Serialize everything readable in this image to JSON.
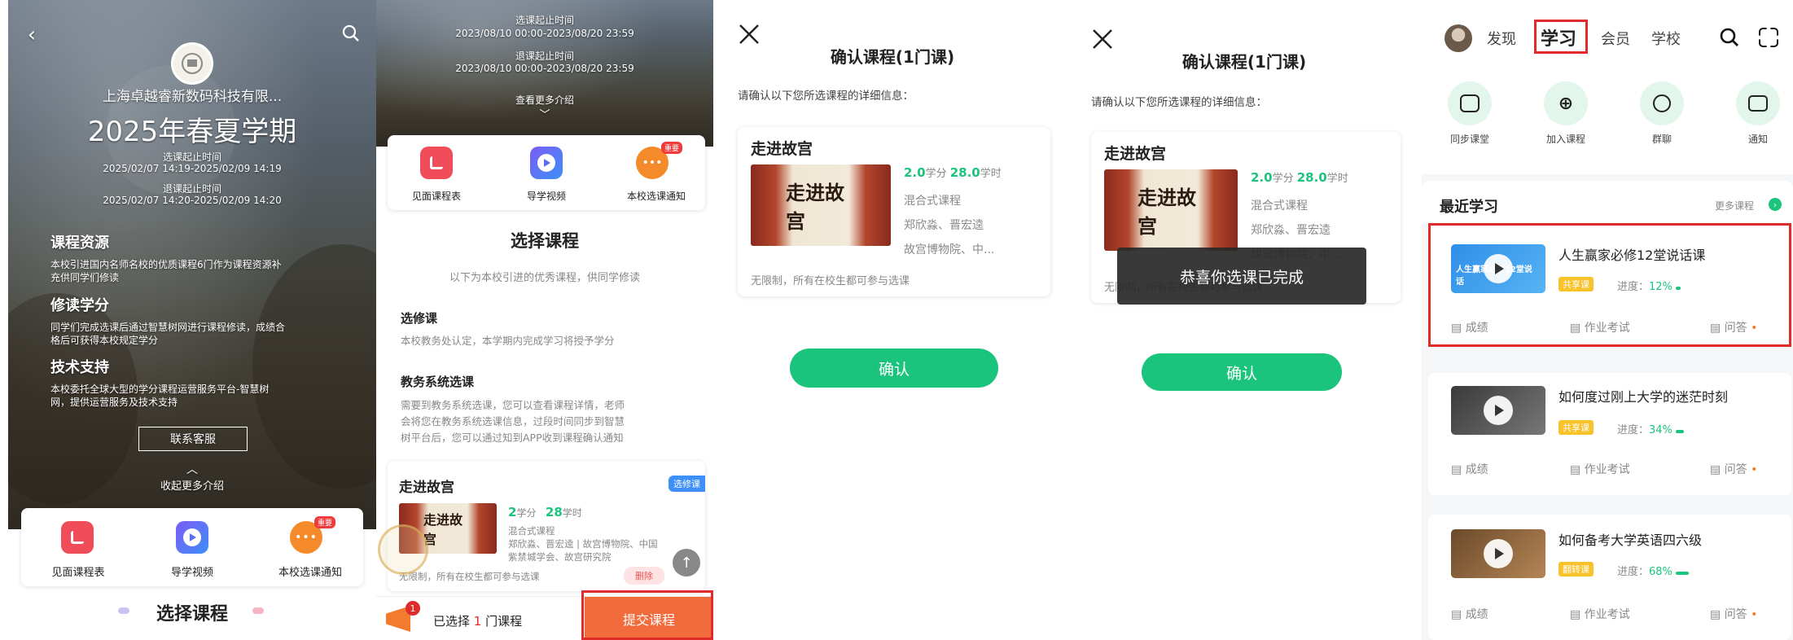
{
  "p1": {
    "org": "上海卓越睿新数码科技有限...",
    "term": "2025年春夏学期",
    "sel_label": "选课起止时间",
    "sel_time": "2025/02/07 14:19-2025/02/09 14:19",
    "drop_label": "退课起止时间",
    "drop_time": "2025/02/07 14:20-2025/02/09 14:20",
    "sections": [
      {
        "title": "课程资源",
        "body1": "本校引进国内名师名校的优质课程6门作为课程资源补",
        "body2": "充供同学们修读"
      },
      {
        "title": "修读学分",
        "body1": "同学们完成选课后通过智慧树网进行课程修读，成绩合",
        "body2": "格后可获得本校规定学分"
      },
      {
        "title": "技术支持",
        "body1": "本校委托全球大型的学分课程运营服务平台-智慧树",
        "body2": "网，提供运营服务及技术支持"
      }
    ],
    "contact": "联系客服",
    "collapse": "收起更多介绍",
    "quick": [
      "见面课程表",
      "导学视频",
      "本校选课通知"
    ],
    "badge": "重要",
    "select_title": "选择课程"
  },
  "p2": {
    "sel_label": "选课起止时间",
    "sel_time": "2023/08/10 00:00-2023/08/20 23:59",
    "drop_label": "退课起止时间",
    "drop_time": "2023/08/10 00:00-2023/08/20 23:59",
    "more": "查看更多介绍",
    "quick": [
      "见面课程表",
      "导学视频",
      "本校选课通知"
    ],
    "badge": "重要",
    "select_title": "选择课程",
    "subtitle": "以下为本校引进的优秀课程，供同学修读",
    "s1_title": "选修课",
    "s1_body": "本校教务处认定，本学期内完成学习将授予学分",
    "s2_title": "教务系统选课",
    "s2_b1": "需要到教务系统选课，您可以查看课程详情，老师",
    "s2_b2": "会将您在教务系统选课信息，过段时间同步到智慧",
    "s2_b3": "树平台后，您可以通过知到APP收到课程确认通知",
    "course": {
      "name": "走进故宫",
      "tag": "选修课",
      "credit": "2",
      "credit_unit": "学分",
      "hours": "28",
      "hours_unit": "学时",
      "mode": "混合式课程",
      "teachers1": "郑欣淼、晋宏逵 | 故宫博物院、中国",
      "teachers2": "紫禁城学会、故宫研究院",
      "note": "无限制，所有在校生都可参与选课",
      "delete": "删除",
      "thumb_text": "走进故宫"
    },
    "selected_prefix": "已选择",
    "selected_count": "1",
    "selected_suffix": "门课程",
    "cart_badge": "1",
    "submit": "提交课程"
  },
  "dialog": {
    "title": "确认课程(1门课)",
    "desc": "请确认以下您所选课程的详细信息：",
    "name": "走进故宫",
    "credit": "2.0",
    "credit_unit": "学分",
    "hours": "28.0",
    "hours_unit": "学时",
    "mode": "混合式课程",
    "teachers": "郑欣淼、晋宏逵",
    "inst": "故宫博物院、中...",
    "note": "无限制，所有在校生都可参与选课",
    "confirm": "确认",
    "thumb_text": "走进故宫",
    "toast": "恭喜你选课已完成"
  },
  "p5": {
    "tabs": [
      "发现",
      "学习",
      "会员",
      "学校"
    ],
    "icons": [
      "同步课堂",
      "加入课程",
      "群聊",
      "通知"
    ],
    "recent": "最近学习",
    "more": "更多课程",
    "courses": [
      {
        "title": "人生赢家必修12堂说话课",
        "tag": "共享课",
        "progress_label": "进度：",
        "progress": "12%",
        "thumb": "人生赢家必修12堂说话"
      },
      {
        "title": "如何度过刚上大学的迷茫时刻",
        "tag": "共享课",
        "progress_label": "进度：",
        "progress": "34%",
        "thumb": ""
      },
      {
        "title": "如何备考大学英语四六级",
        "tag": "翻转课",
        "progress_label": "进度：",
        "progress": "68%",
        "thumb": ""
      }
    ],
    "actions": [
      "成绩",
      "作业考试",
      "问答"
    ]
  },
  "colors": {
    "green": "#1bc47d",
    "red": "#e02b2b",
    "orange": "#f37b2e"
  }
}
